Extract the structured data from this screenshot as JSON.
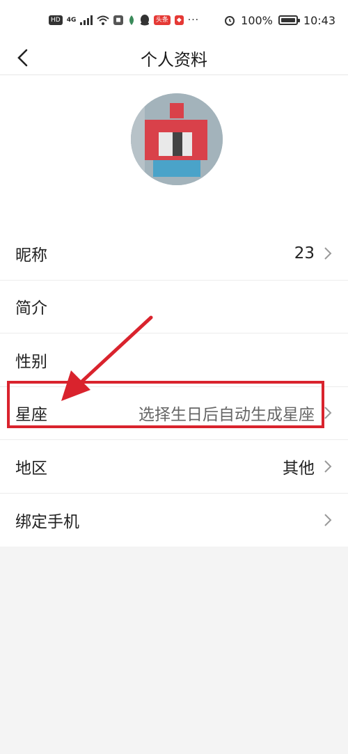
{
  "status_bar": {
    "left_chips": [
      "HD",
      "4G"
    ],
    "battery": "100%",
    "time": "10:43",
    "icons": [
      "signal-icon",
      "wifi-icon",
      "app-icon",
      "leaf-icon",
      "qq-icon",
      "toutiao-icon",
      "app-red-icon",
      "more-dots-icon",
      "alarm-icon",
      "battery-icon"
    ]
  },
  "nav": {
    "title": "个人资料",
    "back_icon": "back-chevron-icon"
  },
  "profile_rows": [
    {
      "label": "昵称",
      "value": "23",
      "hint": false,
      "chevron": true
    },
    {
      "label": "简介",
      "value": "",
      "hint": false,
      "chevron": false
    },
    {
      "label": "性别",
      "value": "",
      "hint": false,
      "chevron": false
    },
    {
      "label": "星座",
      "value": "选择生日后自动生成星座",
      "hint": true,
      "chevron": true
    },
    {
      "label": "地区",
      "value": "其他",
      "hint": false,
      "chevron": true
    },
    {
      "label": "绑定手机",
      "value": "",
      "hint": false,
      "chevron": true
    }
  ],
  "colors": {
    "highlight": "#d9232d",
    "avatar_bg": "#a3b3bb",
    "avatar_red": "#d9414a",
    "avatar_blue": "#4aa3c9"
  }
}
